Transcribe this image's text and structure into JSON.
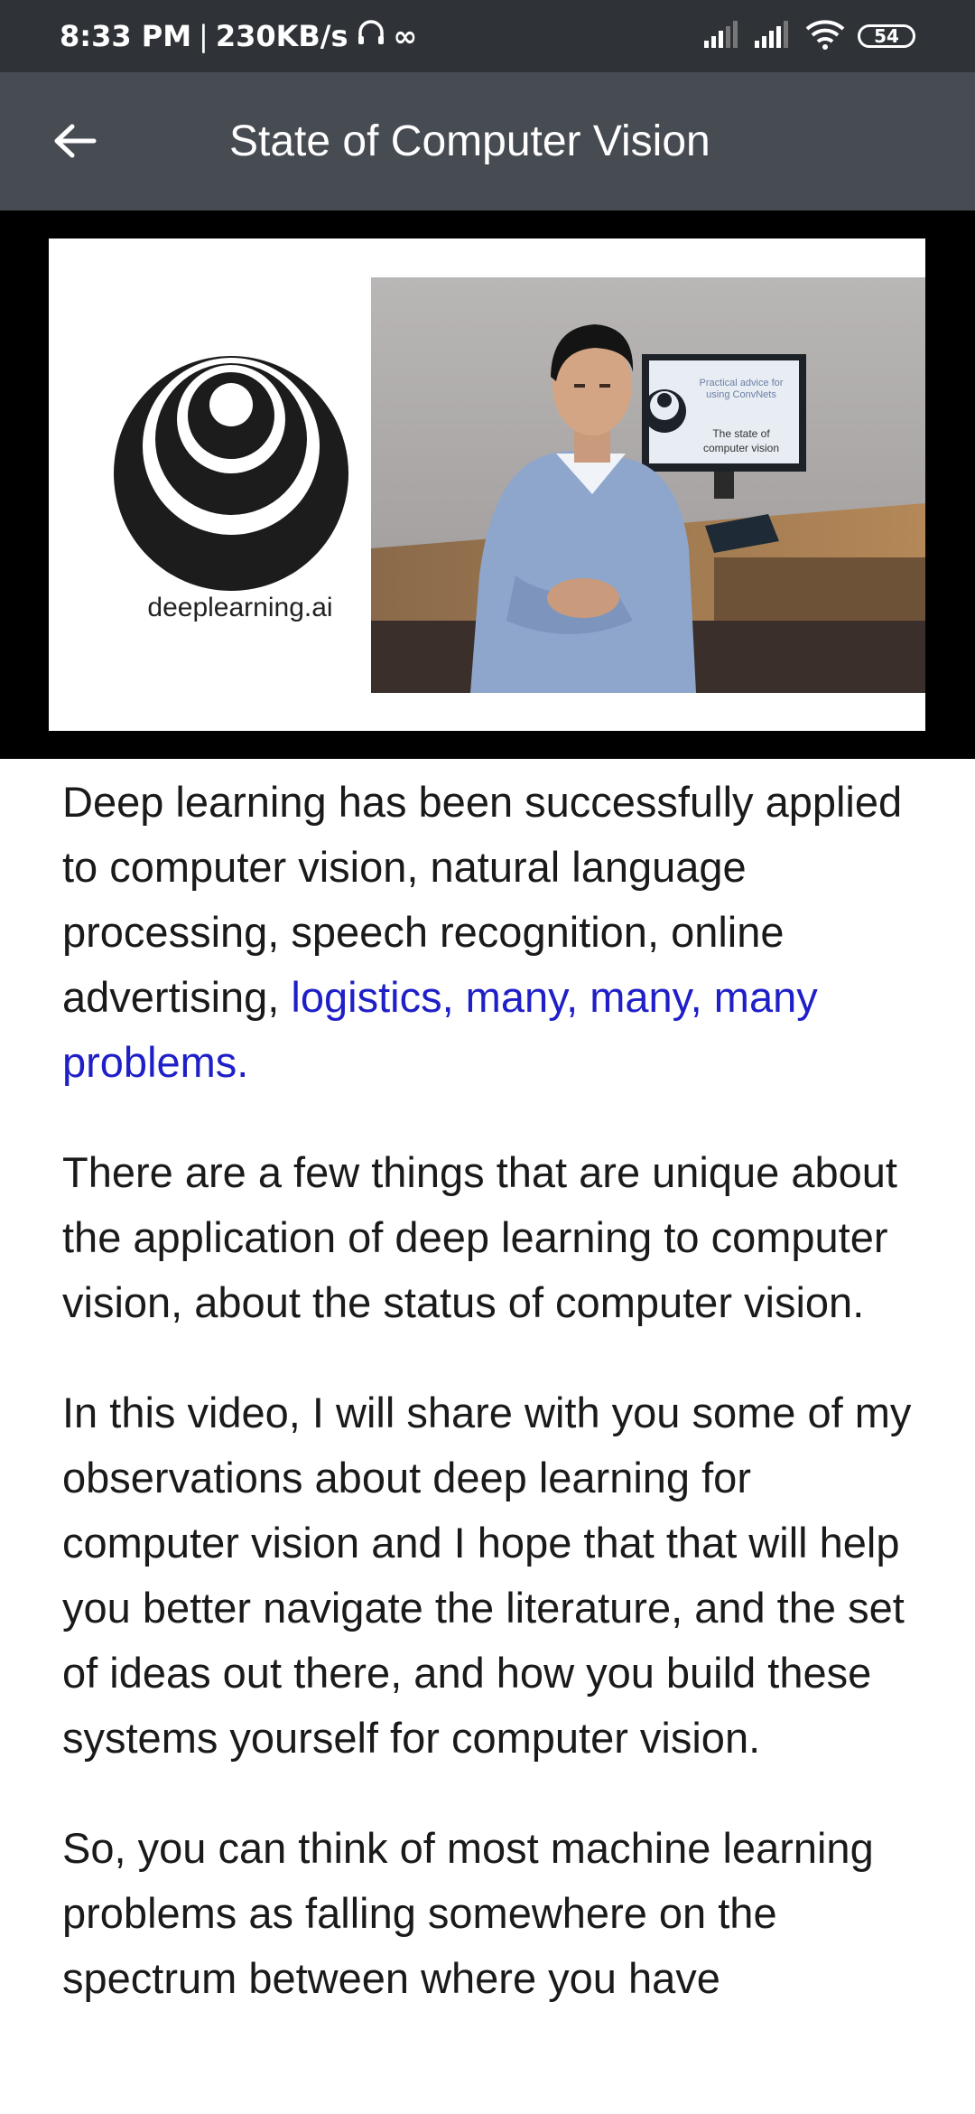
{
  "status_bar": {
    "time": "8:33 PM",
    "separator": "|",
    "network_speed": "230KB/s",
    "infinity": "∞",
    "battery": "54"
  },
  "app_bar": {
    "title": "State of Computer Vision"
  },
  "video": {
    "logo_text": "deeplearning.ai",
    "screen_line1": "Practical advice for",
    "screen_line2": "using ConvNets",
    "screen_line3": "The state of",
    "screen_line4": "computer vision"
  },
  "transcript": {
    "p1_plain": "Deep learning has been successfully applied to computer vision, natural language processing, speech recognition, online advertising, ",
    "p1_link": "logistics, many, many, many problems.",
    "p2": "There are a few things that are unique about the application of deep learning to computer vision, about the status of computer vision.",
    "p3": "In this video, I will share with you some of my observations about deep learning for computer vision and I hope that that will help you better navigate the literature, and the set of ideas out there, and how you build these systems yourself for computer vision.",
    "p4": "So, you can think of most machine learning problems as falling somewhere on the spectrum between where you have"
  },
  "colors": {
    "status_bg": "#2f3338",
    "app_bar_bg": "#474b52",
    "link": "#1f1fc8"
  },
  "icons": [
    "back-arrow-icon",
    "headphones-icon",
    "signal-icon",
    "wifi-icon",
    "battery-icon"
  ]
}
